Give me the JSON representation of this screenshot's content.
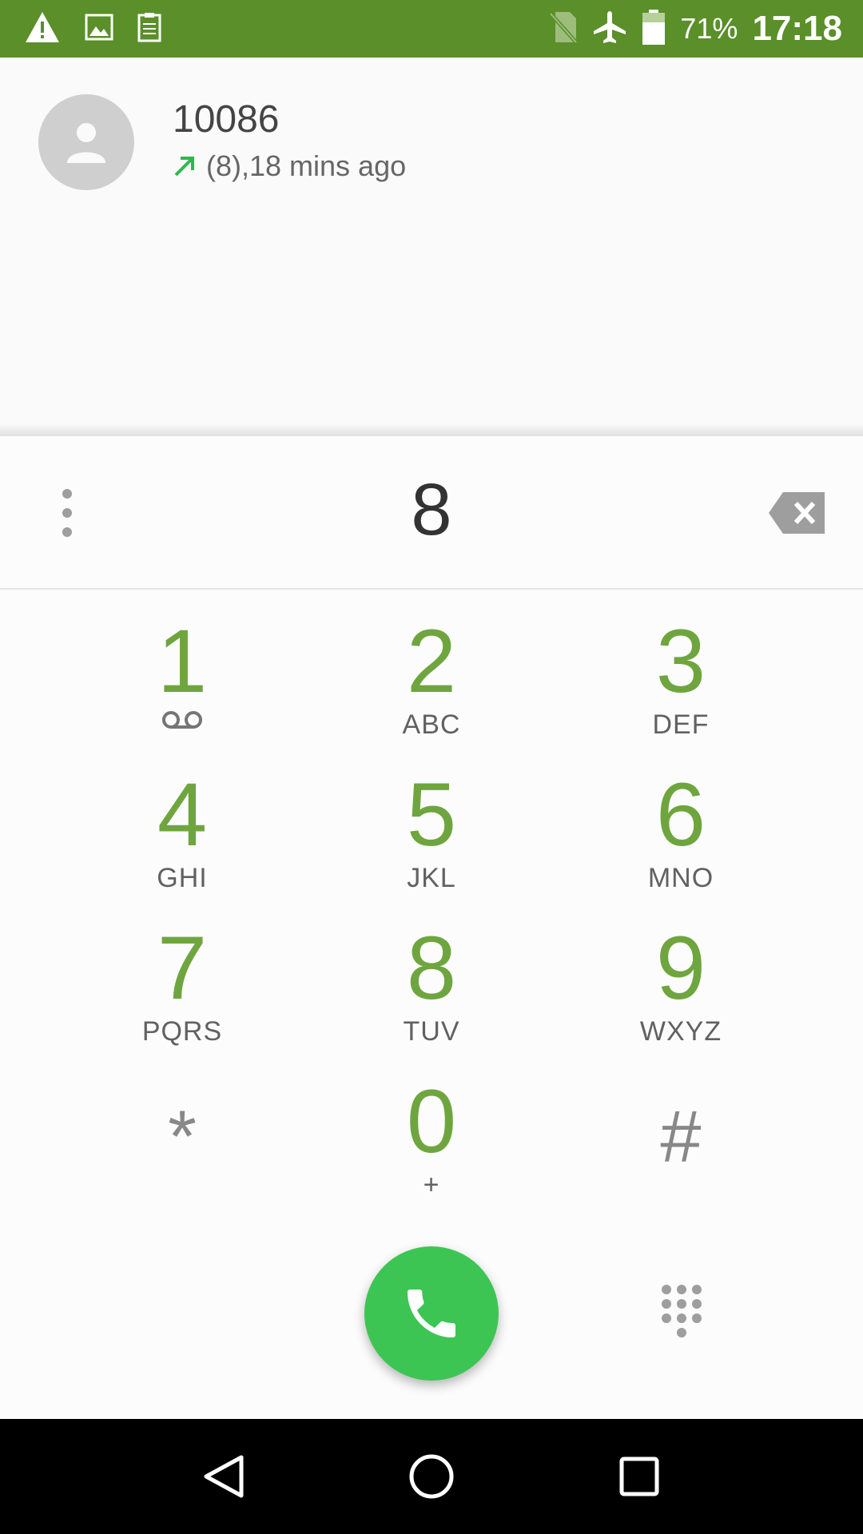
{
  "status_bar": {
    "battery_percent": "71%",
    "time": "17:18",
    "icons_left": [
      "warning-icon",
      "image-icon",
      "log-icon"
    ],
    "icons_right": [
      "no-sim-icon",
      "airplane-icon",
      "battery-icon"
    ],
    "background": "#5a8f29"
  },
  "suggestion": {
    "number": "10086",
    "meta": "(8),18 mins ago",
    "call_type": "outgoing"
  },
  "dialer": {
    "entered_digits": "8"
  },
  "keys": [
    {
      "digit": "1",
      "letters": ""
    },
    {
      "digit": "2",
      "letters": "ABC"
    },
    {
      "digit": "3",
      "letters": "DEF"
    },
    {
      "digit": "4",
      "letters": "GHI"
    },
    {
      "digit": "5",
      "letters": "JKL"
    },
    {
      "digit": "6",
      "letters": "MNO"
    },
    {
      "digit": "7",
      "letters": "PQRS"
    },
    {
      "digit": "8",
      "letters": "TUV"
    },
    {
      "digit": "9",
      "letters": "WXYZ"
    },
    {
      "digit": "*",
      "letters": ""
    },
    {
      "digit": "0",
      "letters": "+"
    },
    {
      "digit": "#",
      "letters": ""
    }
  ],
  "colors": {
    "accent_green": "#6fa53f",
    "call_green": "#3dc553"
  }
}
